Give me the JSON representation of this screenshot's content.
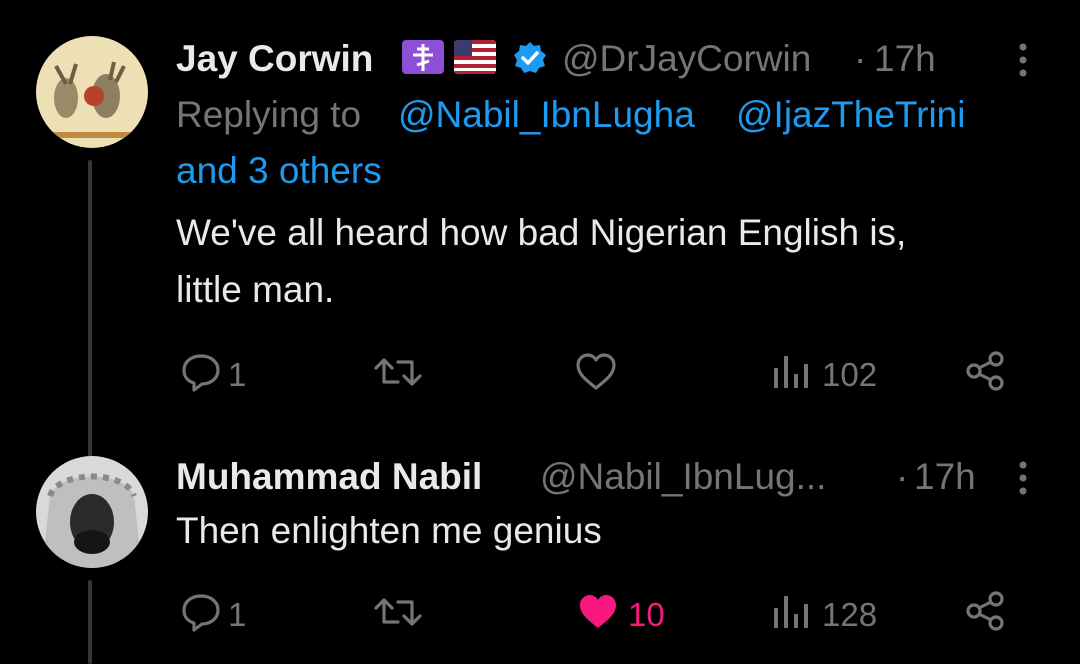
{
  "tweet1": {
    "author_name": "Jay Corwin",
    "handle": "@DrJayCorwin",
    "separator": "·",
    "time": "17h",
    "replying_label": "Replying to",
    "reply_user1": "@Nabil_IbnLugha",
    "reply_user2": "@IjazTheTrini",
    "reply_others": "and 3 others",
    "text_line1": "We've all heard how bad Nigerian English is,",
    "text_line2": "little man.",
    "actions": {
      "replies": "1",
      "reposts": "",
      "likes": "",
      "views": "102"
    },
    "badges": [
      "orthodox-cross-emoji",
      "us-flag-emoji",
      "verified-badge-icon"
    ]
  },
  "tweet2": {
    "author_name": "Muhammad Nabil",
    "handle": "@Nabil_IbnLug...",
    "separator": "·",
    "time": "17h",
    "text": "Then enlighten me genius",
    "actions": {
      "replies": "1",
      "reposts": "",
      "likes": "10",
      "views": "128"
    },
    "liked": true
  },
  "colors": {
    "background": "#000000",
    "text": "#e7e9ea",
    "muted": "#71767b",
    "link": "#1d9bf0",
    "like": "#f91880",
    "verified": "#1d9bf0"
  }
}
